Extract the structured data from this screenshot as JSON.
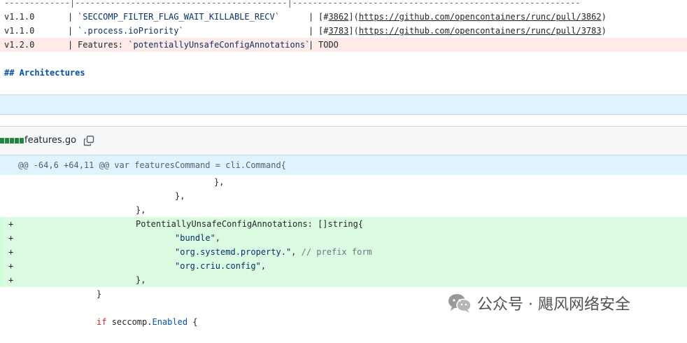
{
  "table": {
    "separator": "-------------|------------------------------------------|---------------------------------------------------------",
    "rows": [
      {
        "version": "v1.1.0",
        "pipe1": "|",
        "feature": "`SECCOMP_FILTER_FLAG_WAIT_KILLABLE_RECV`",
        "pipe2": "|",
        "ref_open": "[#",
        "ref_num": "3862",
        "ref_mid": "](",
        "ref_url": "https://github.com/opencontainers/runc/pull/3862",
        "ref_close": ")"
      },
      {
        "version": "v1.1.0",
        "pipe1": "|",
        "feature": "`.process.ioPriority`",
        "pipe2": "|",
        "ref_open": "[#",
        "ref_num": "3783",
        "ref_mid": "](",
        "ref_url": "https://github.com/opencontainers/runc/pull/3783",
        "ref_close": ")"
      },
      {
        "version": "v1.2.0",
        "pipe1": "|",
        "feature_prefix": "Features: ",
        "feature": "`potentiallyUnsafeConfigAnnotations`",
        "pipe2": "|",
        "todo": "TODO"
      }
    ]
  },
  "heading": "## Architectures",
  "file": {
    "name": "features.go",
    "diffstat_blocks": 5,
    "hunk_header": "@@ -64,6 +64,11 @@ var featuresCommand = cli.Command{"
  },
  "code": {
    "l1": "},",
    "l2": "},",
    "l3": "},",
    "a1": "PotentiallyUnsafeConfigAnnotations: []string{",
    "a2": "\"bundle\",",
    "a3_str": "\"org.systemd.property.\",",
    "a3_comment": "// prefix form",
    "a4": "\"org.criu.config\",",
    "a5": "},",
    "l4": "}",
    "l5_kw": "if",
    "l5_obj": "seccomp.",
    "l5_field": "Enabled",
    "l5_brace": " {",
    "plus": "+"
  },
  "watermark": {
    "text": "公众号 · 飓风网络安全"
  },
  "colors": {
    "added_bg": "#dafbe1",
    "removed_bg": "#ffebe9",
    "hunk_bg": "#ddf4ff",
    "diffstat": "#1f883d"
  }
}
